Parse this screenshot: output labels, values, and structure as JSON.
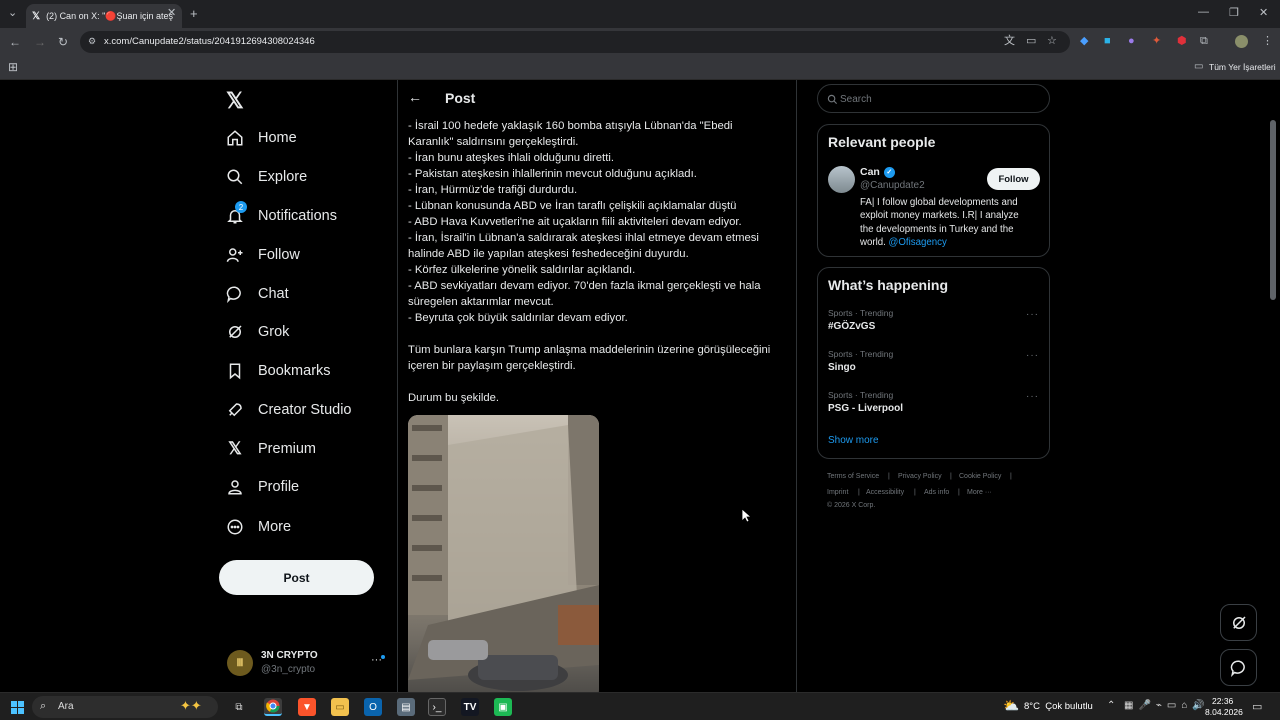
{
  "browser": {
    "tab_title": "(2) Can on X: \"🔴Şuan için ateş",
    "url": "x.com/Canupdate2/status/2041912694308024346",
    "bookmarks_label": "Tüm Yer İşaretleri"
  },
  "sidebar": {
    "items": [
      {
        "label": "Home",
        "icon": "home-icon"
      },
      {
        "label": "Explore",
        "icon": "search-icon"
      },
      {
        "label": "Notifications",
        "icon": "bell-icon",
        "badge": "2"
      },
      {
        "label": "Follow",
        "icon": "person-add-icon"
      },
      {
        "label": "Chat",
        "icon": "chat-icon"
      },
      {
        "label": "Grok",
        "icon": "grok-icon"
      },
      {
        "label": "Bookmarks",
        "icon": "bookmark-icon"
      },
      {
        "label": "Creator Studio",
        "icon": "rocket-icon"
      },
      {
        "label": "Premium",
        "icon": "x-logo-icon"
      },
      {
        "label": "Profile",
        "icon": "person-icon"
      },
      {
        "label": "More",
        "icon": "more-circle-icon"
      }
    ],
    "post_button": "Post",
    "account": {
      "name": "3N CRYPTO",
      "handle": "@3n_crypto"
    }
  },
  "main": {
    "header": "Post",
    "lines": [
      "- İsrail  100 hedefe yaklaşık 160 bomba atışıyla Lübnan'da  \"Ebedi",
      "Karanlık\" saldırısını gerçekleştirdi.",
      "- İran bunu ateşkes ihlali olduğunu diretti.",
      "- Pakistan ateşkesin ihlallerinin mevcut olduğunu açıkladı.",
      "- İran, Hürmüz'de trafiği durdurdu.",
      "- Lübnan konusunda ABD ve İran taraflı çelişkili açıklamalar düştü",
      "- ABD Hava Kuvvetleri'ne ait uçakların fiili aktiviteleri devam ediyor.",
      "- İran, İsrail'in Lübnan'a saldırarak ateşkesi ihlal etmeye devam etmesi",
      "halinde ABD ile yapılan ateşkesi feshedeceğini duyurdu.",
      "- Körfez ülkelerine yönelik saldırılar açıklandı.",
      "- ABD sevkiyatları devam ediyor. 70'den fazla ikmal gerçekleşti ve hala",
      "süregelen aktarımlar mevcut.",
      "- Beyruta çok büyük saldırılar devam ediyor."
    ],
    "paragraph2_line1": "Tüm bunlara karşın Trump anlaşma maddelerinin üzerine görüşüleceğini",
    "paragraph2_line2": "içeren bir paylaşım gerçekleştirdi.",
    "paragraph3": " Durum bu şekilde."
  },
  "right": {
    "search_placeholder": "Search",
    "relevant": {
      "title": "Relevant people",
      "name": "Can",
      "handle": "@Canupdate2",
      "follow": "Follow",
      "bio_lines": [
        "FA| I follow global developments and",
        "exploit money markets. I.R| I analyze",
        "the developments in Turkey and the"
      ],
      "bio_last_prefix": "world. ",
      "bio_mention": "@Ofisagency"
    },
    "happening": {
      "title": "What’s happening",
      "trends": [
        {
          "category": "Sports · Trending",
          "name": "#GÖZvGS"
        },
        {
          "category": "Sports · Trending",
          "name": "Singo"
        },
        {
          "category": "Sports · Trending",
          "name": "PSG - Liverpool"
        }
      ],
      "show_more": "Show more"
    },
    "footer": {
      "row1": [
        "Terms of Service",
        "Privacy Policy",
        "Cookie Policy"
      ],
      "row2": [
        "Imprint",
        "Accessibility",
        "Ads info",
        "More ···"
      ],
      "copyright": "© 2026 X Corp."
    }
  },
  "taskbar": {
    "search_label": "Ara",
    "weather": "8°C  Çok bulutlu",
    "time": "22:36",
    "date": "8.04.2026"
  },
  "colors": {
    "accent": "#1d9bf0",
    "text": "#e7e9ea",
    "muted": "#71767b",
    "border": "#2f3336"
  }
}
